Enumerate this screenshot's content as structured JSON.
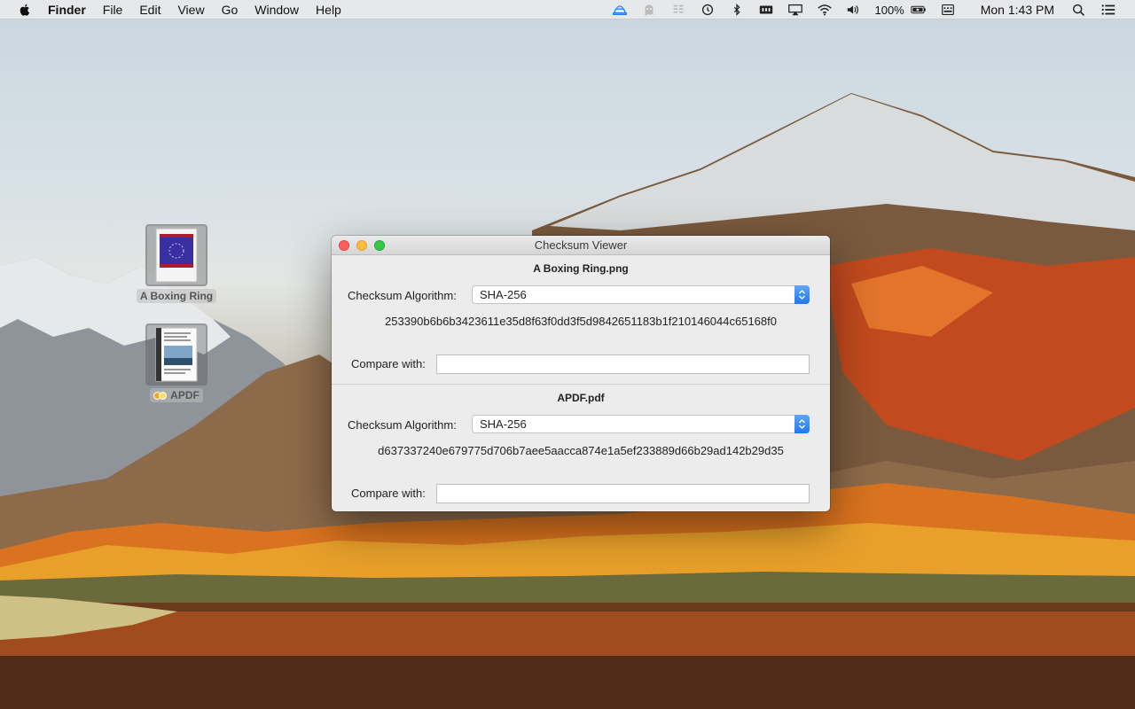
{
  "menubar": {
    "app_name": "Finder",
    "menus": [
      "File",
      "Edit",
      "View",
      "Go",
      "Window",
      "Help"
    ],
    "battery": "100%",
    "clock": "Mon 1:43 PM"
  },
  "desktop": {
    "icons": [
      {
        "label": "A Boxing Ring"
      },
      {
        "label": "APDF"
      }
    ]
  },
  "window": {
    "title": "Checksum Viewer",
    "files": [
      {
        "name": "A Boxing Ring.png",
        "algorithm_label": "Checksum Algorithm:",
        "algorithm": "SHA-256",
        "checksum": "253390b6b6b3423611e35d8f63f0dd3f5d9842651183b1f210146044c65168f0",
        "compare_label": "Compare with:",
        "compare_value": ""
      },
      {
        "name": "APDF.pdf",
        "algorithm_label": "Checksum Algorithm:",
        "algorithm": "SHA-256",
        "checksum": "d637337240e679775d706b7aee5aacca874e1a5ef233889d66b29ad142b29d35",
        "compare_label": "Compare with:",
        "compare_value": ""
      }
    ]
  },
  "colors": {
    "close": "#fc605c",
    "minimize": "#fdbc40",
    "maximize": "#34c84a",
    "accent": "#1f78f2"
  }
}
